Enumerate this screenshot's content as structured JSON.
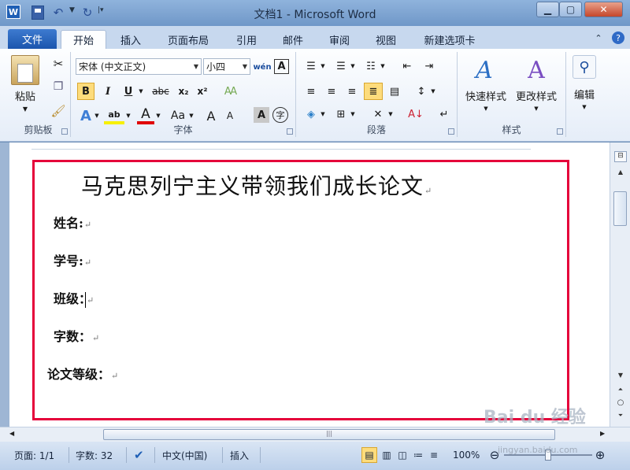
{
  "window": {
    "title": "文档1 - Microsoft Word",
    "app_icon": "W"
  },
  "tabs": [
    "文件",
    "开始",
    "插入",
    "页面布局",
    "引用",
    "邮件",
    "审阅",
    "视图",
    "新建选项卡"
  ],
  "ribbon": {
    "clipboard": {
      "paste_label": "粘贴",
      "group_label": "剪贴板"
    },
    "font": {
      "font_name": "宋体 (中文正文)",
      "font_size": "小四",
      "group_label": "字体",
      "bold": "B",
      "italic": "I",
      "underline": "U",
      "strike": "abc",
      "sub": "x₂",
      "sup": "x²",
      "case": "Aa",
      "grow": "A",
      "shrink": "A",
      "char_shade": "A",
      "enclose": "字",
      "wen": "wén",
      "border_a": "A"
    },
    "paragraph": {
      "group_label": "段落"
    },
    "styles": {
      "quick_label": "快速样式",
      "change_label": "更改样式",
      "group_label": "样式"
    },
    "edit": {
      "label": "编辑"
    }
  },
  "document": {
    "title": "马克思列宁主义带领我们成长论文",
    "fields": [
      "姓名:",
      "学号:",
      "班级：",
      "字数：",
      "论文等级："
    ]
  },
  "status": {
    "page": "页面: 1/1",
    "words": "字数: 32",
    "lang": "中文(中国)",
    "mode": "插入",
    "zoom": "100%"
  },
  "watermark": {
    "brand": "Bai du 经验",
    "url": "jingyan.baidu.com"
  },
  "colors": {
    "highlight": "#f7f000",
    "font_color": "#e00000",
    "frame": "#e5003a",
    "file_tab": "#2a66c1"
  }
}
